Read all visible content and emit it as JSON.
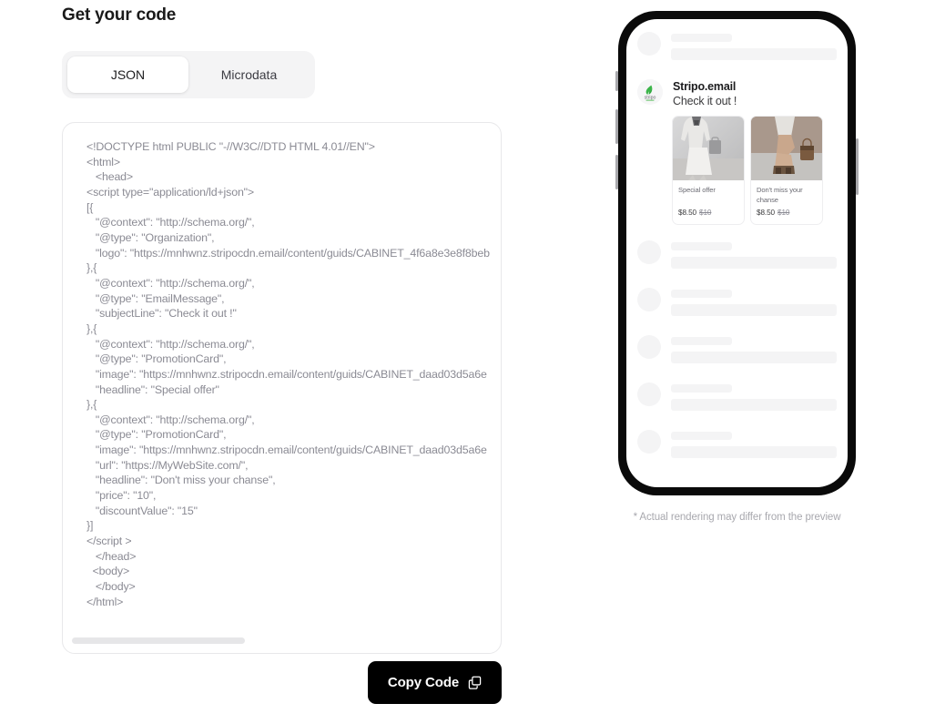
{
  "page": {
    "title": "Get your code"
  },
  "tabs": [
    {
      "label": "JSON",
      "active": true
    },
    {
      "label": "Microdata",
      "active": false
    }
  ],
  "code_panel": {
    "language": "json",
    "lines": [
      "<!DOCTYPE html PUBLIC \"-//W3C//DTD HTML 4.01//EN\">",
      "<html>",
      "   <head>",
      "<script type=\"application/ld+json\">",
      "[{",
      "   \"@context\": \"http://schema.org/\",",
      "   \"@type\": \"Organization\",",
      "   \"logo\": \"https://mnhwnz.stripocdn.email/content/guids/CABINET_4f6a8e3e8f8beb",
      "},{",
      "   \"@context\": \"http://schema.org/\",",
      "   \"@type\": \"EmailMessage\",",
      "   \"subjectLine\": \"Check it out !\"",
      "},{",
      "   \"@context\": \"http://schema.org/\",",
      "   \"@type\": \"PromotionCard\",",
      "   \"image\": \"https://mnhwnz.stripocdn.email/content/guids/CABINET_daad03d5a6e",
      "   \"headline\": \"Special offer\"",
      "},{",
      "   \"@context\": \"http://schema.org/\",",
      "   \"@type\": \"PromotionCard\",",
      "   \"image\": \"https://mnhwnz.stripocdn.email/content/guids/CABINET_daad03d5a6e",
      "   \"url\": \"https://MyWebSite.com/\",",
      "   \"headline\": \"Don't miss your chanse\",",
      "   \"price\": \"10\",",
      "   \"discountValue\": \"15\"",
      "}]",
      "</script >",
      "   </head>",
      "  <body>",
      "   </body>",
      "</html>"
    ],
    "scrollbar": {
      "orientation": "horizontal",
      "thumb_position_pct": 0
    }
  },
  "copy_button": {
    "label": "Copy Code",
    "icon": "copy-icon",
    "background_color": "#000000",
    "text_color": "#ffffff"
  },
  "preview": {
    "device": "phone",
    "disclaimer": "* Actual rendering may differ from the preview",
    "email": {
      "sender": "Stripo.email",
      "subject": "Check it out !",
      "avatar_icon": "stripo-logo-icon",
      "cards": [
        {
          "title": "Special offer",
          "price": "$8.50",
          "old_price": "$10",
          "image_alt": "woman-with-handbag-photo"
        },
        {
          "title": "Don't miss your chanse",
          "price": "$8.50",
          "old_price": "$10",
          "image_alt": "woman-sitting-with-bag-photo"
        }
      ]
    },
    "skeleton_rows_above": 1,
    "skeleton_rows_below": 5
  },
  "colors": {
    "page_background": "#ffffff",
    "tab_track": "#f4f4f5",
    "panel_border": "#e8e8ea",
    "code_text": "#8b8b94",
    "skeleton": "#f4f4f5",
    "accent_dark": "#000000",
    "muted_text": "#a8a8ae"
  }
}
